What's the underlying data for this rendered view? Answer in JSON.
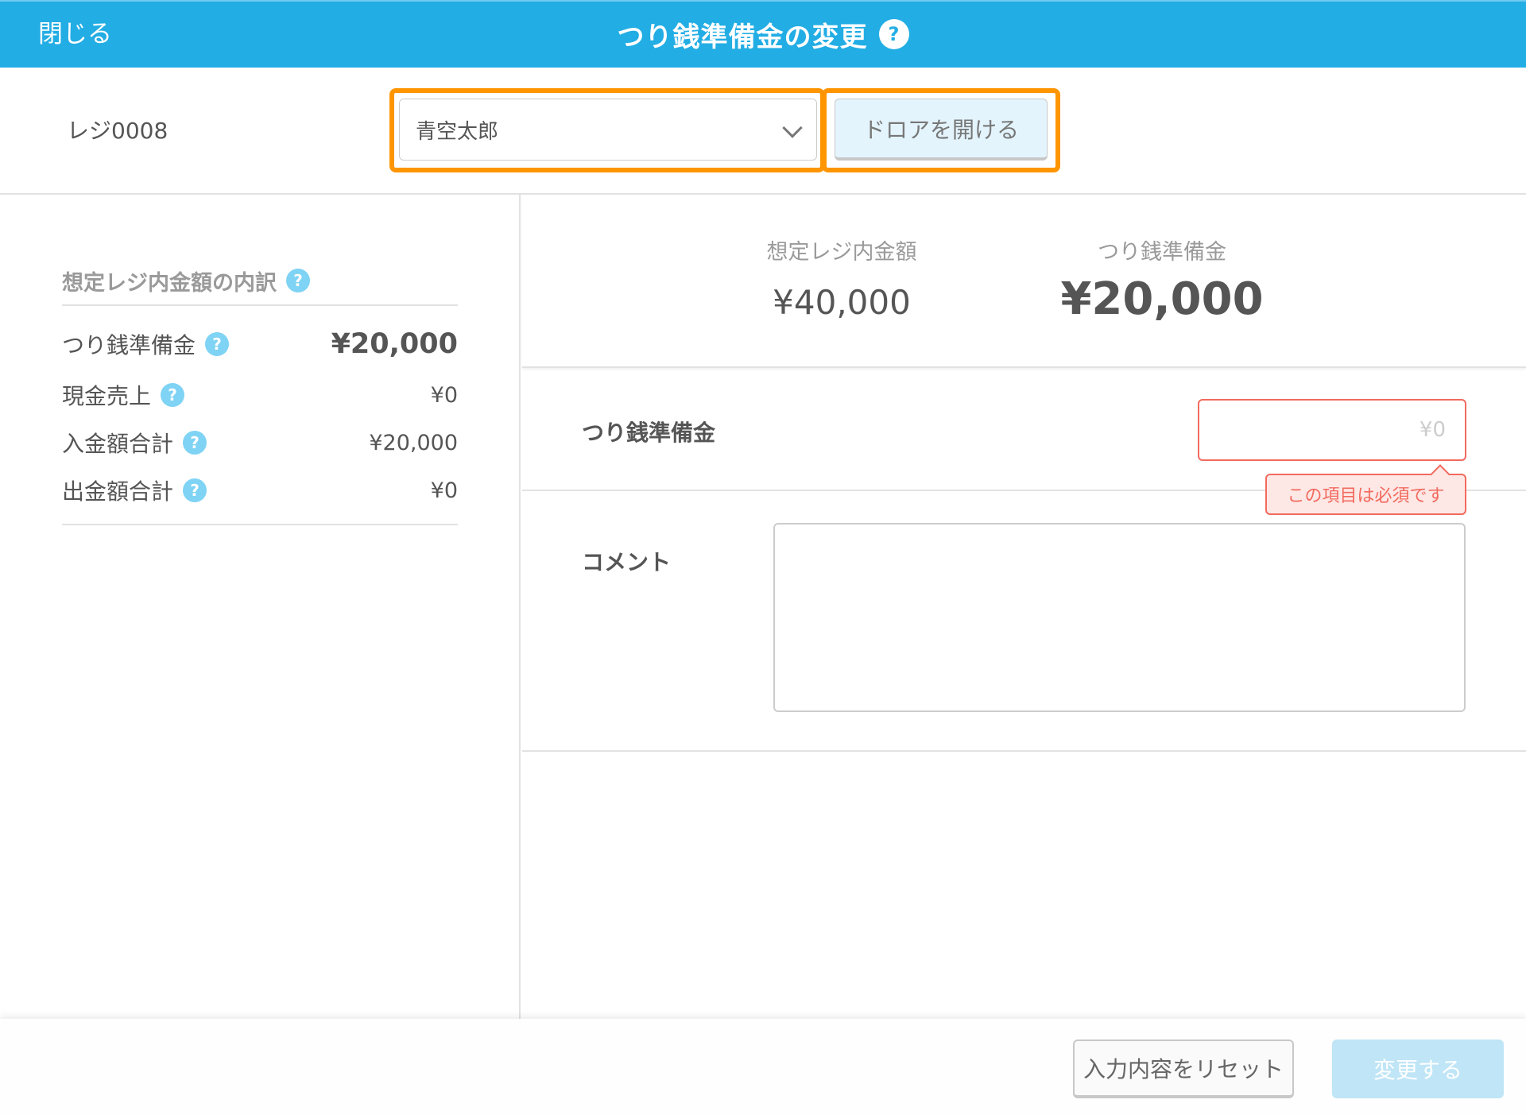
{
  "header": {
    "close_label": "閉じる",
    "title": "つり銭準備金の変更",
    "help_icon": "?"
  },
  "toolbar": {
    "register_name": "レジ0008",
    "staff_select": {
      "value": "青空太郎"
    },
    "open_drawer_label": "ドロアを開ける",
    "highlight_color": "#ff9500"
  },
  "breakdown": {
    "title": "想定レジ内金額の内訳",
    "help_icon": "?",
    "rows": [
      {
        "label": "つり銭準備金",
        "amount": "¥20,000"
      },
      {
        "label": "現金売上",
        "amount": "¥0"
      },
      {
        "label": "入金額合計",
        "amount": "¥20,000"
      },
      {
        "label": "出金額合計",
        "amount": "¥0"
      }
    ]
  },
  "summary": {
    "expected_label": "想定レジ内金額",
    "expected_value": "¥40,000",
    "float_label": "つり銭準備金",
    "float_value": "¥20,000"
  },
  "form": {
    "float_label": "つり銭準備金",
    "float_input": {
      "value": "",
      "placeholder": "¥0"
    },
    "float_error": "この項目は必須です",
    "comment_label": "コメント",
    "comment_value": ""
  },
  "footer": {
    "reset_label": "入力内容をリセット",
    "submit_label": "変更する"
  },
  "colors": {
    "brand": "#22ade4",
    "error": "#f26a5e",
    "help_icon": "#7fd3f4",
    "submit_disabled": "#bfe5f6"
  }
}
